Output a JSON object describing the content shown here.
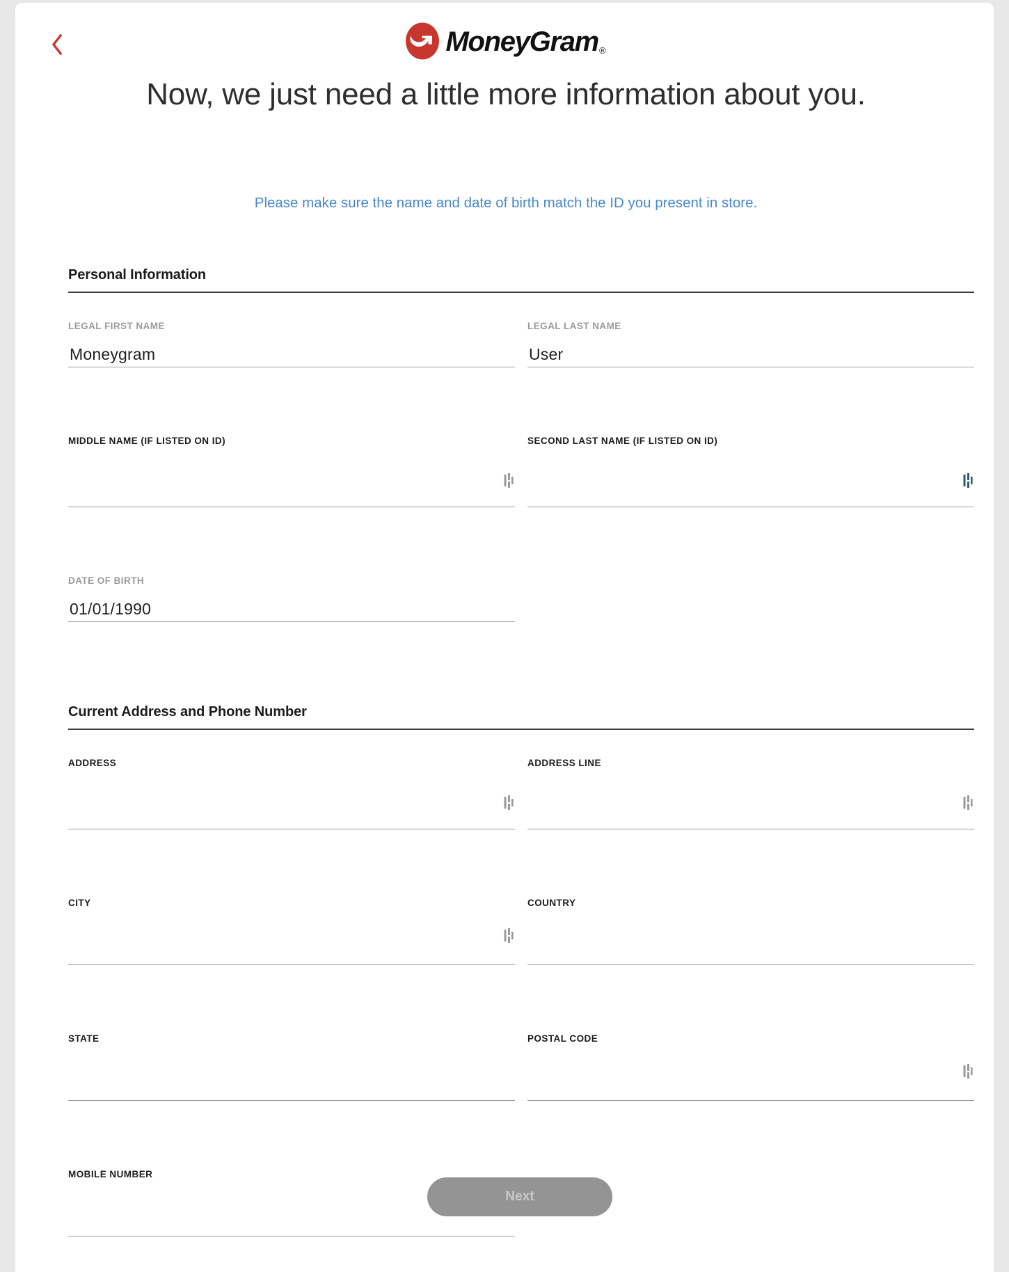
{
  "brand": {
    "name": "MoneyGram",
    "registered_mark": "®",
    "logo_color": "#C8372D",
    "accent_blue": "#4A88C7"
  },
  "header": {
    "back_label": "Back",
    "back_icon": "chevron-left-icon"
  },
  "headline": "Now, we just need a little more information about you.",
  "subheadline": "Please make sure the name and date of birth match the ID you present in store.",
  "sections": [
    {
      "title": "Personal Information",
      "rows": [
        {
          "fields": [
            {
              "label": "LEGAL FIRST NAME",
              "value": "Moneygram",
              "label_style": "muted",
              "glyph": null
            },
            {
              "label": "LEGAL LAST NAME",
              "value": "User",
              "label_style": "muted",
              "glyph": null
            }
          ]
        },
        {
          "fields": [
            {
              "label": "MIDDLE NAME (IF LISTED ON ID)",
              "value": "",
              "label_style": "dark",
              "glyph": "gray"
            },
            {
              "label": "SECOND LAST NAME (IF LISTED ON ID)",
              "value": "",
              "label_style": "dark",
              "glyph": "teal"
            }
          ]
        },
        {
          "fields": [
            {
              "label": "DATE OF BIRTH",
              "value": "01/01/1990",
              "label_style": "muted",
              "glyph": null
            },
            {
              "label": "",
              "value": "",
              "label_style": "muted",
              "glyph": null,
              "hidden": true
            }
          ]
        }
      ]
    },
    {
      "title": "Current Address and Phone Number",
      "rows": [
        {
          "fields": [
            {
              "label": "ADDRESS",
              "value": "",
              "label_style": "dark",
              "glyph": "gray"
            },
            {
              "label": "ADDRESS LINE",
              "value": "",
              "label_style": "dark",
              "glyph": "gray"
            }
          ]
        },
        {
          "fields": [
            {
              "label": "CITY",
              "value": "",
              "label_style": "dark",
              "glyph": "gray-mid"
            },
            {
              "label": "COUNTRY",
              "value": "",
              "label_style": "dark",
              "glyph": null
            }
          ]
        },
        {
          "fields": [
            {
              "label": "STATE",
              "value": "",
              "label_style": "dark",
              "glyph": null
            },
            {
              "label": "POSTAL CODE",
              "value": "",
              "label_style": "dark",
              "glyph": "gray-mid"
            }
          ]
        },
        {
          "fields": [
            {
              "label": "MOBILE NUMBER",
              "value": "",
              "label_style": "dark",
              "glyph": "teal-mid"
            },
            {
              "label": "",
              "value": "",
              "label_style": "dark",
              "glyph": null,
              "hidden": true
            }
          ]
        }
      ]
    }
  ],
  "footer": {
    "next_label": "Next",
    "next_enabled": false
  }
}
